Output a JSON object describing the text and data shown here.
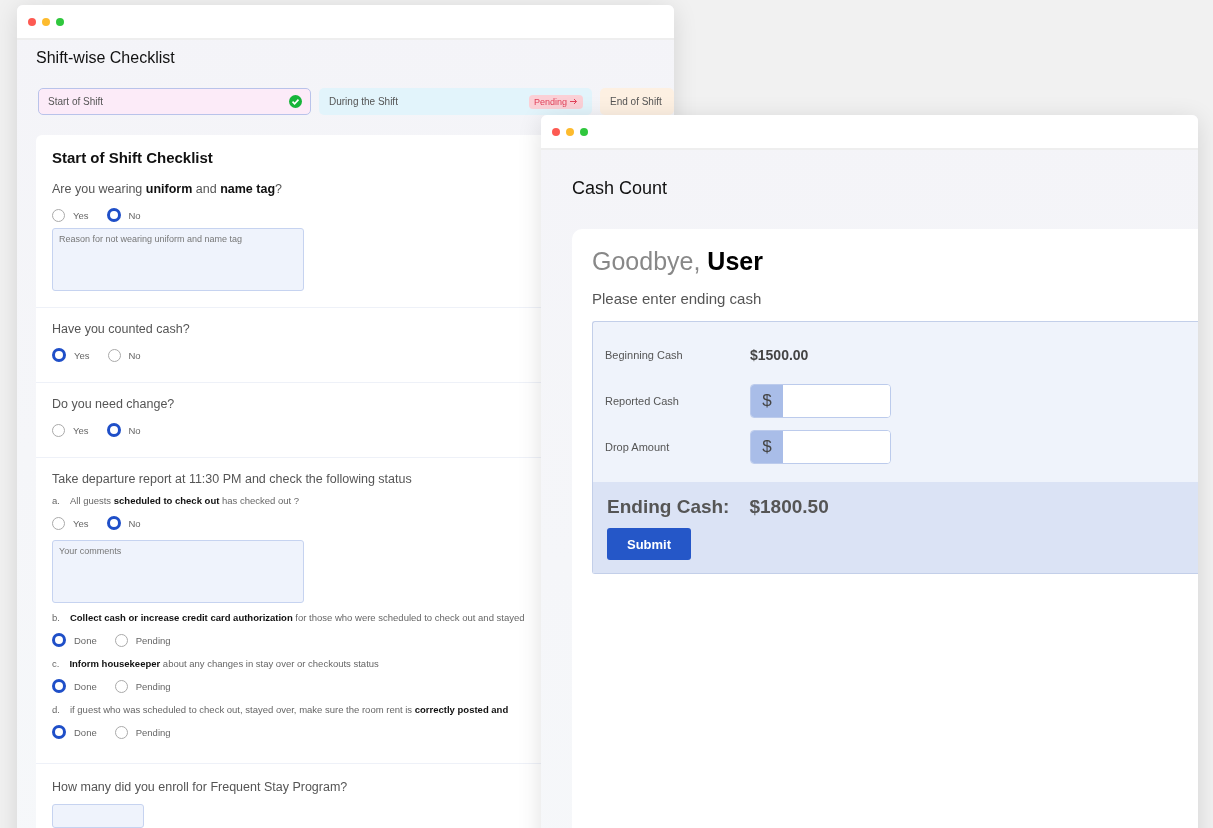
{
  "checklist_window": {
    "title": "Shift-wise Checklist",
    "tabs": [
      {
        "label": "Start of Shift",
        "selected": true,
        "complete": true,
        "color": "#fcebf8"
      },
      {
        "label": "During the Shift",
        "selected": false,
        "complete": false,
        "badge": "Pending",
        "color": "#e2f4fb"
      },
      {
        "label": "End of Shift",
        "selected": false,
        "complete": false,
        "color": "#fdf0e2"
      }
    ],
    "card_title": "Start of Shift Checklist",
    "sections": [
      {
        "kind": "question",
        "question": "Are you wearing **uniform** and **name tag**?",
        "options": [
          {
            "label": "Yes",
            "selected": false
          },
          {
            "label": "No",
            "selected": true
          }
        ],
        "placeholder": "Reason for not wearing uniform and name tag"
      },
      {
        "kind": "question",
        "question": "Have you counted cash?",
        "options": [
          {
            "label": "Yes",
            "selected": true
          },
          {
            "label": "No",
            "selected": false
          }
        ]
      },
      {
        "kind": "question",
        "question": "Do you need change?",
        "options": [
          {
            "label": "Yes",
            "selected": false
          },
          {
            "label": "No",
            "selected": true
          }
        ]
      },
      {
        "kind": "steps",
        "question": "Take departure report at 11:30 PM and check the following status",
        "steps": [
          {
            "marker": "a.",
            "text": "All guests **scheduled to check out** has checked out ?",
            "options": [
              {
                "label": "Yes",
                "selected": false
              },
              {
                "label": "No",
                "selected": true
              }
            ],
            "placeholder": "Your comments"
          },
          {
            "marker": "b.",
            "text": "**Collect cash or increase credit card authorization** for those who were scheduled to check out and stayed",
            "options": [
              {
                "label": "Done",
                "selected": true
              },
              {
                "label": "Pending",
                "selected": false
              }
            ]
          },
          {
            "marker": "c.",
            "text": "**Inform housekeeper** about any changes in stay over or checkouts status",
            "options": [
              {
                "label": "Done",
                "selected": true
              },
              {
                "label": "Pending",
                "selected": false
              }
            ]
          },
          {
            "marker": "d.",
            "text": " if guest who was scheduled to check out, stayed over,  make sure the room rent is **correctly posted and**",
            "options": [
              {
                "label": "Done",
                "selected": true
              },
              {
                "label": "Pending",
                "selected": false
              }
            ]
          }
        ]
      },
      {
        "kind": "number",
        "question": "How many did you enroll for Frequent Stay Program?"
      }
    ]
  },
  "cash_window": {
    "title": "Cash Count",
    "greeting": "Goodbye, **User**",
    "prompt": "Please enter ending cash",
    "rows": [
      {
        "kind": "value",
        "label": "Beginning Cash",
        "value": "$1500.00"
      },
      {
        "kind": "money_input",
        "label": "Reported Cash",
        "prefix": "$"
      },
      {
        "kind": "money_input",
        "label": "Drop Amount",
        "prefix": "$"
      }
    ],
    "ending_label": "Ending Cash:",
    "ending_value": "$1800.50",
    "submit": "Submit"
  }
}
